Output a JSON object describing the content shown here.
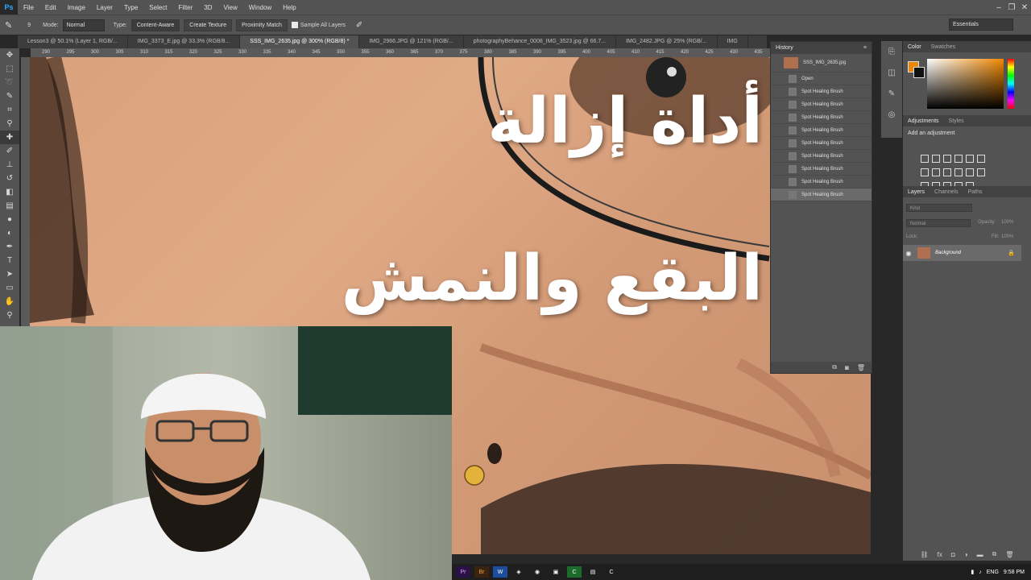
{
  "app": {
    "logo": "Ps"
  },
  "menu": [
    "File",
    "Edit",
    "Image",
    "Layer",
    "Type",
    "Select",
    "Filter",
    "3D",
    "View",
    "Window",
    "Help"
  ],
  "window_controls": [
    "–",
    "❐",
    "✕"
  ],
  "options": {
    "brush_size": "9",
    "mode_label": "Mode:",
    "mode_value": "Normal",
    "type_label": "Type:",
    "type_buttons": [
      "Content-Aware",
      "Create Texture",
      "Proximity Match"
    ],
    "sample_all_layers": "Sample All Layers",
    "workspace": "Essentials"
  },
  "tabs": [
    {
      "label": "Lesson3 @ 50.1% (Layer 1, RGB/...",
      "active": false
    },
    {
      "label": "IMG_3373_E.jpg @ 33.3% (RGB/8...",
      "active": false
    },
    {
      "label": "SSS_IMG_2635.jpg @ 300% (RGB/8) *",
      "active": true
    },
    {
      "label": "IMG_2966.JPG @ 121% (RGB/...",
      "active": false
    },
    {
      "label": "photographyBehance_0008_IMG_3523.jpg @ 66.7...",
      "active": false
    },
    {
      "label": "IMG_2482.JPG @ 25% (RGB/...",
      "active": false
    },
    {
      "label": "IMG",
      "active": false
    }
  ],
  "ruler_ticks": [
    "290",
    "295",
    "300",
    "305",
    "310",
    "315",
    "320",
    "325",
    "330",
    "335",
    "340",
    "345",
    "350",
    "355",
    "360",
    "365",
    "370",
    "375",
    "380",
    "385",
    "390",
    "395",
    "400",
    "405",
    "410",
    "415",
    "420",
    "425",
    "430",
    "435"
  ],
  "overlay": {
    "line1": "أداة إزالة",
    "line2": "البقع والنمش"
  },
  "history": {
    "tab": "History",
    "snapshot": "SSS_IMG_2635.jpg",
    "steps": [
      "Open",
      "Spot Healing Brush",
      "Spot Healing Brush",
      "Spot Healing Brush",
      "Spot Healing Brush",
      "Spot Healing Brush",
      "Spot Healing Brush",
      "Spot Healing Brush",
      "Spot Healing Brush",
      "Spot Healing Brush"
    ]
  },
  "color_panel": {
    "tabs": [
      "Color",
      "Swatches"
    ],
    "fg": "#e8870b",
    "bg": "#111111"
  },
  "adjustments": {
    "tabs": [
      "Adjustments",
      "Styles"
    ],
    "label": "Add an adjustment"
  },
  "layers": {
    "tabs": [
      "Layers",
      "Channels",
      "Paths"
    ],
    "kind_placeholder": "Kind",
    "blend_mode": "Normal",
    "opacity_label": "Opacity:",
    "opacity_value": "100%",
    "lock_label": "Lock:",
    "fill_label": "Fill:",
    "fill_value": "100%",
    "layer_name": "Background"
  },
  "taskbar": {
    "apps": [
      "Pr",
      "Br",
      "W",
      "◈",
      "◉",
      "▣",
      "C",
      "▤",
      "C"
    ],
    "lang": "ENG",
    "time": "9:58 PM"
  }
}
